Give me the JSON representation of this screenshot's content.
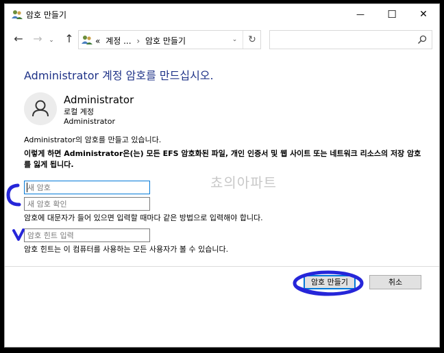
{
  "window": {
    "title": "암호 만들기",
    "minimize": "—",
    "maximize": "☐",
    "close": "✕"
  },
  "nav": {
    "back": "←",
    "forward": "→",
    "recent": "⌄",
    "up": "↑",
    "breadcrumb_prefix": "«",
    "breadcrumb_parent": "계정 ...",
    "breadcrumb_sep": "›",
    "breadcrumb_current": "암호 만들기",
    "dropdown": "⌄",
    "refresh": "↻",
    "search_placeholder": ""
  },
  "content": {
    "heading": "Administrator 계정 암호를 만드십시오.",
    "user_name": "Administrator",
    "user_type": "로컬 계정",
    "user_sub": "Administrator",
    "info_line": "Administrator의 암호를 만들고 있습니다.",
    "warning": "이렇게 하면 Administrator은(는) 모든 EFS 암호화된 파일, 개인 인증서 및 웹 사이트 또는 네트워크 리소스의 저장 암호를 잃게 됩니다.",
    "new_password_placeholder": "새 암호",
    "confirm_password_placeholder": "새 암호 확인",
    "case_note": "암호에 대문자가 들어 있으면 입력할 때마다 같은 방법으로 입력해야 합니다.",
    "hint_placeholder": "암호 힌트 입력",
    "hint_note": "암호 힌트는 이 컴퓨터를 사용하는 모든 사용자가 볼 수 있습니다.",
    "watermark": "쵸의아파트"
  },
  "buttons": {
    "create": "암호 만들기",
    "cancel": "취소"
  },
  "colors": {
    "heading": "#1e3287",
    "accent": "#0078d7",
    "annotation": "#2626d9"
  }
}
